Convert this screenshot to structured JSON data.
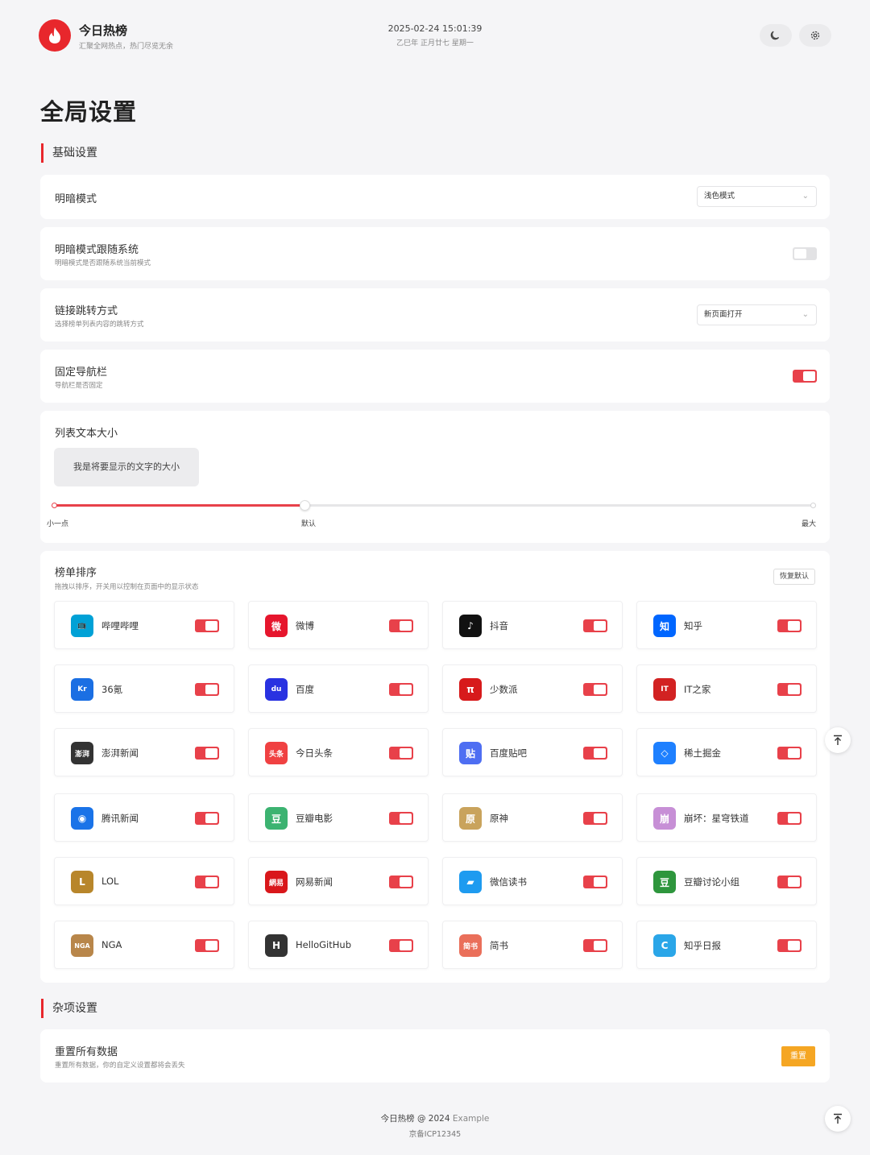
{
  "header": {
    "title": "今日热榜",
    "subtitle": "汇聚全网热点，热门尽览无余",
    "datetime": "2025-02-24 15:01:39",
    "lunar": "乙巳年 正月廿七 星期一"
  },
  "page_title": "全局设置",
  "basic_section": {
    "title": "基础设置",
    "theme": {
      "label": "明暗模式",
      "value": "浅色模式"
    },
    "follow_system": {
      "label": "明暗模式跟随系统",
      "desc": "明暗模式是否跟随系统当前模式",
      "enabled": false
    },
    "link_mode": {
      "label": "链接跳转方式",
      "desc": "选择榜单列表内容的跳转方式",
      "value": "新页面打开"
    },
    "fixed_nav": {
      "label": "固定导航栏",
      "desc": "导航栏是否固定",
      "enabled": true
    },
    "font_size": {
      "label": "列表文本大小",
      "preview": "我是将要显示的文字的大小",
      "level": 0.33,
      "marks": {
        "min": "小一点",
        "mid": "默认",
        "max": "最大"
      }
    }
  },
  "sort_section": {
    "title": "榜单排序",
    "desc": "拖拽以排序，开关用以控制在页面中的显示状态",
    "reset_label": "恢复默认",
    "items": [
      {
        "name": "哔哩哔哩",
        "icon": "bilibili-icon",
        "glyph": "📺",
        "color": "#00a1d6",
        "enabled": true
      },
      {
        "name": "微博",
        "icon": "weibo-icon",
        "glyph": "微",
        "color": "#e6162d",
        "enabled": true
      },
      {
        "name": "抖音",
        "icon": "douyin-icon",
        "glyph": "♪",
        "color": "#111111",
        "enabled": true
      },
      {
        "name": "知乎",
        "icon": "zhihu-icon",
        "glyph": "知",
        "color": "#0066ff",
        "enabled": true
      },
      {
        "name": "36氪",
        "icon": "36kr-icon",
        "glyph": "Kr",
        "color": "#1b6fe3",
        "enabled": true
      },
      {
        "name": "百度",
        "icon": "baidu-icon",
        "glyph": "du",
        "color": "#2932e1",
        "enabled": true
      },
      {
        "name": "少数派",
        "icon": "sspai-icon",
        "glyph": "π",
        "color": "#d71a1b",
        "enabled": true
      },
      {
        "name": "IT之家",
        "icon": "ithome-icon",
        "glyph": "IT",
        "color": "#d22222",
        "enabled": true
      },
      {
        "name": "澎湃新闻",
        "icon": "thepaper-icon",
        "glyph": "澎湃",
        "color": "#333333",
        "enabled": true
      },
      {
        "name": "今日头条",
        "icon": "toutiao-icon",
        "glyph": "头条",
        "color": "#f04142",
        "enabled": true
      },
      {
        "name": "百度贴吧",
        "icon": "tieba-icon",
        "glyph": "贴",
        "color": "#4e6ef2",
        "enabled": true
      },
      {
        "name": "稀土掘金",
        "icon": "juejin-icon",
        "glyph": "◇",
        "color": "#1e80ff",
        "enabled": true
      },
      {
        "name": "腾讯新闻",
        "icon": "qqnews-icon",
        "glyph": "◉",
        "color": "#1a73e8",
        "enabled": true
      },
      {
        "name": "豆瓣电影",
        "icon": "douban-movie-icon",
        "glyph": "豆",
        "color": "#3cb371",
        "enabled": true
      },
      {
        "name": "原神",
        "icon": "genshin-icon",
        "glyph": "原",
        "color": "#c9a35c",
        "enabled": true
      },
      {
        "name": "崩坏：星穹铁道",
        "icon": "starrail-icon",
        "glyph": "崩",
        "color": "#c78fd6",
        "enabled": true
      },
      {
        "name": "LOL",
        "icon": "lol-icon",
        "glyph": "L",
        "color": "#b8862b",
        "enabled": true
      },
      {
        "name": "网易新闻",
        "icon": "netease-news-icon",
        "glyph": "網易",
        "color": "#d9171b",
        "enabled": true
      },
      {
        "name": "微信读书",
        "icon": "weread-icon",
        "glyph": "▰",
        "color": "#1e9bf0",
        "enabled": true
      },
      {
        "name": "豆瓣讨论小组",
        "icon": "douban-group-icon",
        "glyph": "豆",
        "color": "#2e963d",
        "enabled": true
      },
      {
        "name": "NGA",
        "icon": "nga-icon",
        "glyph": "NGA",
        "color": "#b8864a",
        "enabled": true
      },
      {
        "name": "HelloGitHub",
        "icon": "hellogithub-icon",
        "glyph": "H",
        "color": "#333333",
        "enabled": true
      },
      {
        "name": "简书",
        "icon": "jianshu-icon",
        "glyph": "简书",
        "color": "#ea6f5a",
        "enabled": true
      },
      {
        "name": "知乎日报",
        "icon": "zhihu-daily-icon",
        "glyph": "C",
        "color": "#2aa6e8",
        "enabled": true
      }
    ]
  },
  "misc_section": {
    "title": "杂项设置",
    "reset": {
      "label": "重置所有数据",
      "desc": "重置所有数据，你的自定义设置都将会丢失",
      "button": "重置"
    }
  },
  "footer": {
    "brand": "今日热榜",
    "copyright": "@ 2024",
    "link": "Example",
    "icp": "京备ICP12345"
  },
  "colors": {
    "accent": "#e8272c",
    "toggle_on": "#e8414a",
    "warning": "#f5a623"
  }
}
